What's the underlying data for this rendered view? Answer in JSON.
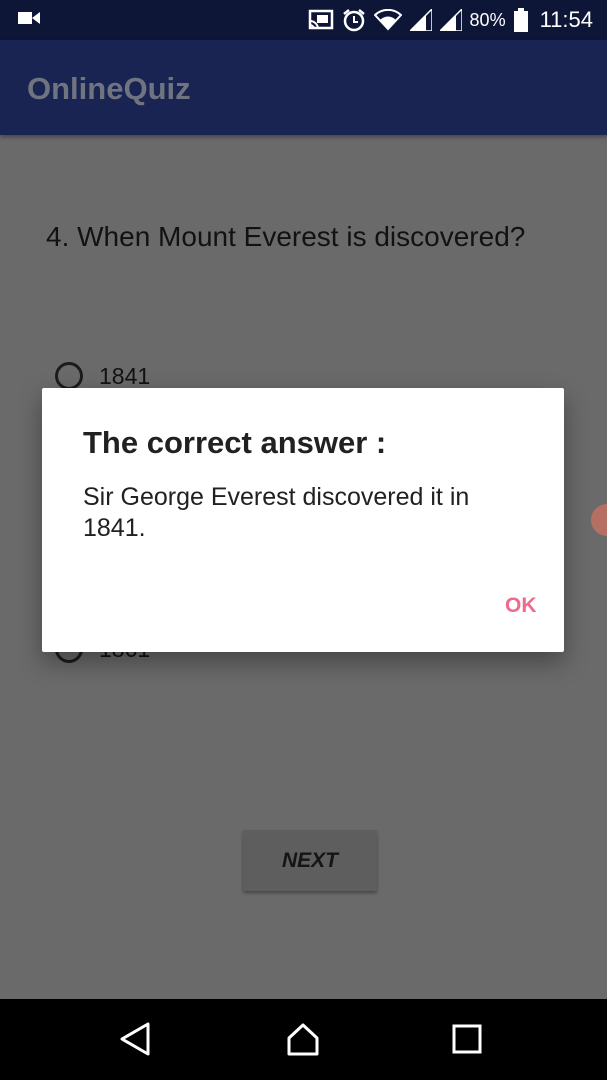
{
  "status_bar": {
    "battery_percent": "80%",
    "time": "11:54",
    "icons": [
      "video-camera-icon",
      "cast-icon",
      "alarm-icon",
      "wifi-icon",
      "signal-icon",
      "signal-icon",
      "battery-icon"
    ]
  },
  "app_bar": {
    "title": "OnlineQuiz"
  },
  "quiz": {
    "question": "4. When Mount Everest is discovered?",
    "options": [
      {
        "label": "1841"
      },
      {
        "label": "1861"
      }
    ],
    "next_label": "NEXT"
  },
  "dialog": {
    "title": "The correct answer :",
    "message": "Sir George Everest discovered it in 1841.",
    "ok_label": "OK"
  },
  "nav_bar": {
    "icons": [
      "back-icon",
      "home-icon",
      "recents-icon"
    ]
  },
  "colors": {
    "status_bar": "#0e1638",
    "app_bar": "#1a2453",
    "scrim_background": "#6a6a6a",
    "dialog_accent": "#ef6a8e"
  }
}
